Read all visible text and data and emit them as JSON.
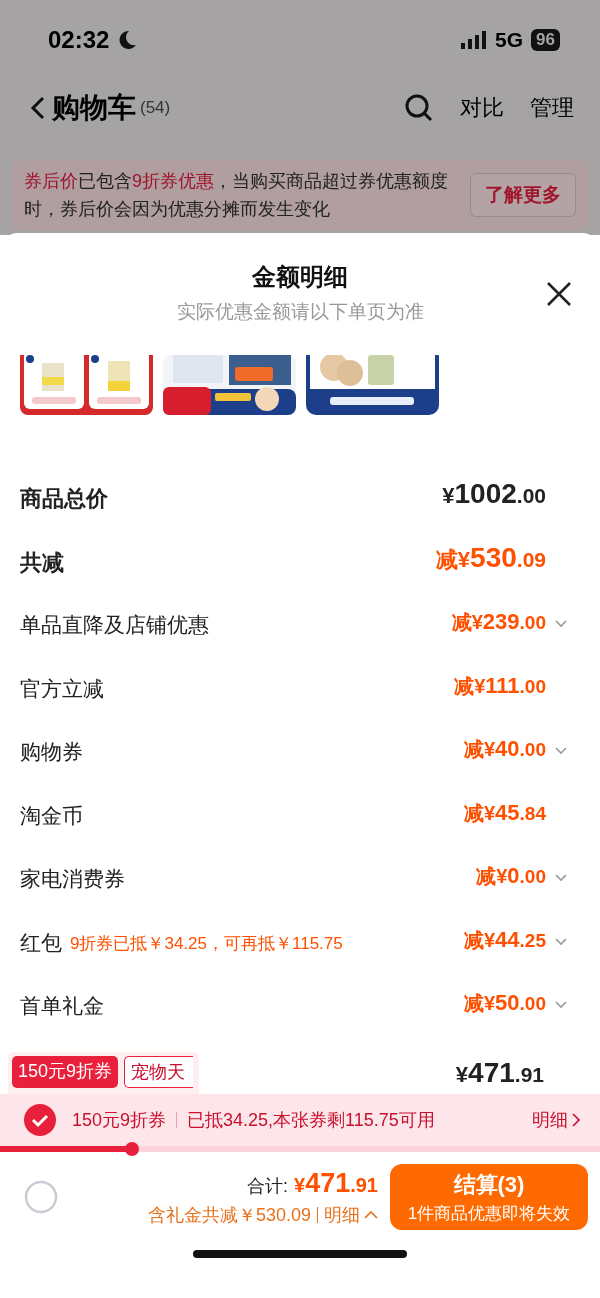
{
  "status_bar": {
    "time": "02:32",
    "network": "5G",
    "battery": "96"
  },
  "nav": {
    "title": "购物车",
    "count": "(54)",
    "actions": [
      "对比",
      "管理"
    ]
  },
  "notice": {
    "parts": [
      {
        "text": "券后价",
        "kind": "highlight"
      },
      {
        "text": "已包含",
        "kind": "plain"
      },
      {
        "text": "9折券优惠",
        "kind": "highlight"
      },
      {
        "text": "，当购买商品超过券优惠额度时，券后价会因为优惠分摊而发生变化",
        "kind": "plain"
      }
    ],
    "button": "了解更多"
  },
  "sheet": {
    "title": "金额明细",
    "subtitle": "实际优惠金额请以下单页为准",
    "rows": [
      {
        "label": "商品总价",
        "kind": "total",
        "prefix": "¥",
        "integer": "1002",
        "decimal": ".00",
        "expandable": false
      },
      {
        "label": "共减",
        "kind": "discount_total",
        "prefix": "减¥",
        "integer": "530",
        "decimal": ".09",
        "expandable": false
      },
      {
        "label": "单品直降及店铺优惠",
        "kind": "item",
        "prefix": "减¥",
        "integer": "239",
        "decimal": ".00",
        "expandable": true
      },
      {
        "label": "官方立减",
        "kind": "item",
        "prefix": "减¥",
        "integer": "111",
        "decimal": ".00",
        "expandable": false
      },
      {
        "label": "购物券",
        "kind": "item",
        "prefix": "减¥",
        "integer": "40",
        "decimal": ".00",
        "expandable": true
      },
      {
        "label": "淘金币",
        "kind": "item",
        "prefix": "减¥",
        "integer": "45",
        "decimal": ".84",
        "expandable": false
      },
      {
        "label": "家电消费券",
        "kind": "item",
        "prefix": "减¥",
        "integer": "0",
        "decimal": ".00",
        "expandable": true
      },
      {
        "label": "红包",
        "note": "9折券已抵￥34.25，可再抵￥115.75",
        "kind": "item",
        "prefix": "减¥",
        "integer": "44",
        "decimal": ".25",
        "expandable": true
      },
      {
        "label": "首单礼金",
        "kind": "item",
        "prefix": "减¥",
        "integer": "50",
        "decimal": ".00",
        "expandable": true
      }
    ]
  },
  "coupon_tags": [
    {
      "label": "150元9折券",
      "kind": "filled"
    },
    {
      "label": "宠物天",
      "kind": "outline"
    }
  ],
  "item_price": {
    "prefix": "¥",
    "integer": "471",
    "decimal": ".91"
  },
  "coupon_bar": {
    "checked": true,
    "name": "150元9折券",
    "detail": "已抵34.25,本张券剩115.75可用",
    "link": "明细",
    "progress": {
      "level": 0.22
    }
  },
  "footer": {
    "select_all": {
      "checked": false
    },
    "total_label": "合计:",
    "prefix": "¥",
    "integer": "471",
    "decimal": ".91",
    "saving": "含礼金共减￥530.09",
    "detail_link": "明细",
    "checkout": "结算(3)",
    "checkout_note": "1件商品优惠即将失效"
  }
}
